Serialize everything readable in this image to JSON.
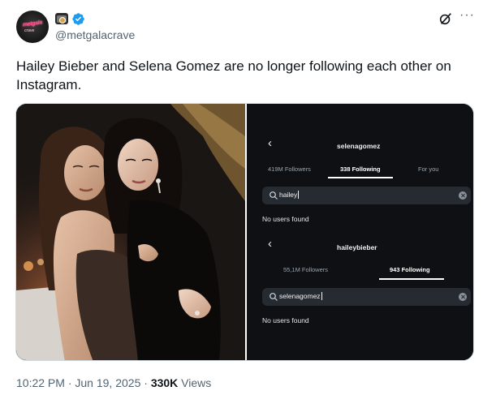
{
  "account": {
    "handle": "@metgalacrave",
    "avatar_text": "metgala",
    "avatar_subtext": "crave",
    "badges": [
      "camera-emoji-icon",
      "verified-badge-icon"
    ]
  },
  "tweet": {
    "text": "Hailey Bieber and Selena Gomez are no longer following each other on Instagram."
  },
  "screenshot_panel": {
    "first": {
      "username": "selenagomez",
      "tabs": [
        "419M Followers",
        "338 Following",
        "For you"
      ],
      "active_tab": "338 Following",
      "search_value": "hailey",
      "result": "No users found"
    },
    "second": {
      "username": "haileybieber",
      "tabs": [
        "55,1M Followers",
        "943 Following"
      ],
      "active_tab": "943 Following",
      "search_value": "selenagomez",
      "result": "No users found"
    }
  },
  "meta": {
    "time": "10:22 PM",
    "separator": "·",
    "date": "Jun 19, 2025",
    "views_count": "330K",
    "views_label": "Views"
  },
  "colors": {
    "secondary_text": "#536471",
    "verified_blue": "#1d9bf0",
    "dark_panel": "#0e1014"
  }
}
